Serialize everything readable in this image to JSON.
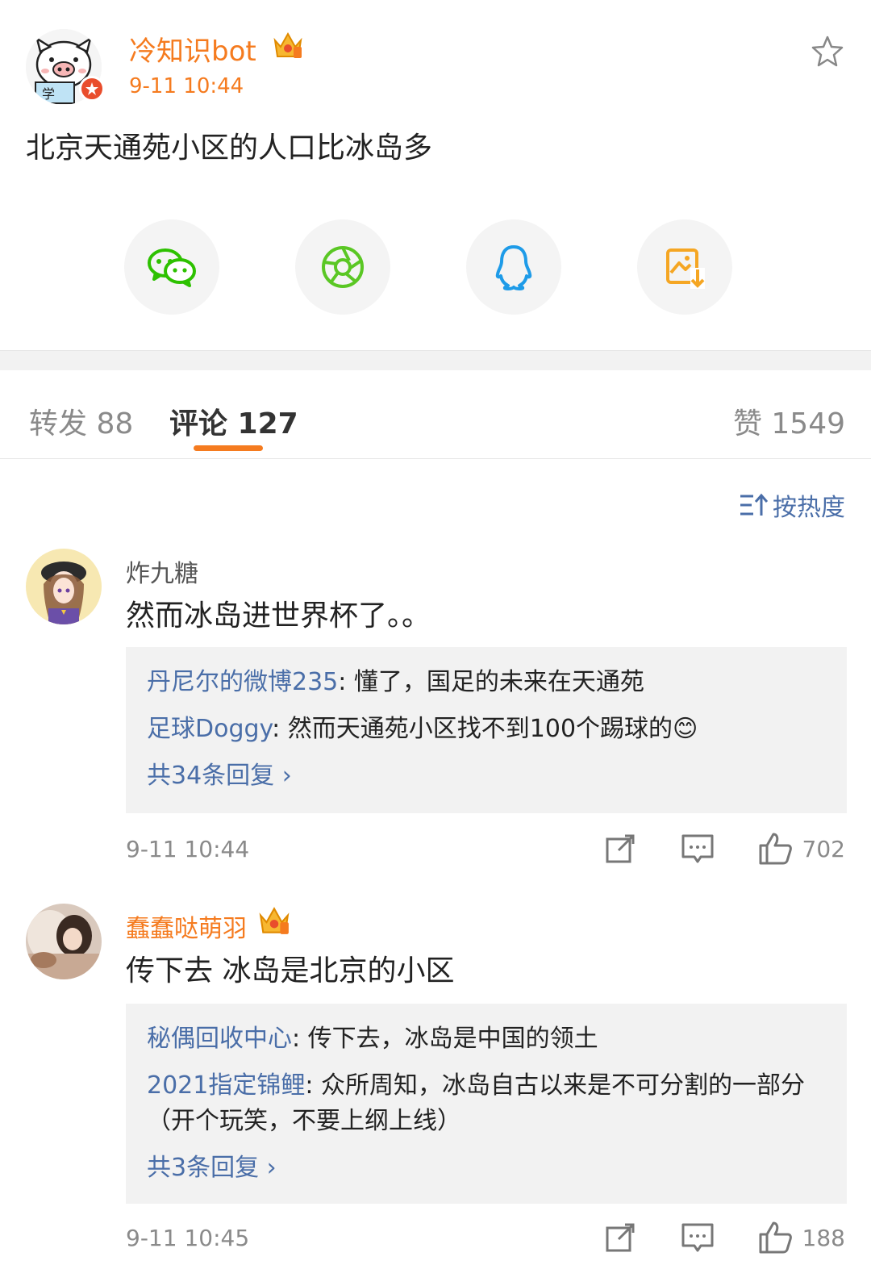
{
  "post": {
    "username": "冷知识bot",
    "time": "9-11 10:44",
    "text": "北京天通苑小区的人口比冰岛多"
  },
  "tabs": {
    "repost": "转发 88",
    "comment": "评论 127",
    "like": "赞 1549"
  },
  "sort_label": "按热度",
  "comments": [
    {
      "username": "炸九糖",
      "text": "然而冰岛进世界杯了。。",
      "replies": [
        {
          "user": "丹尼尔的微博235",
          "sep": ": ",
          "text": "懂了，国足的未来在天通苑"
        },
        {
          "user": "足球Doggy",
          "sep": ": ",
          "text": "然而天通苑小区找不到100个踢球的😊"
        }
      ],
      "more": "共34条回复",
      "time": "9-11 10:44",
      "likes": "702"
    },
    {
      "username": "蠢蠢哒萌羽",
      "text": "传下去 冰岛是北京的小区",
      "replies": [
        {
          "user": "秘偶回收中心",
          "sep": ": ",
          "text": "传下去，冰岛是中国的领土"
        },
        {
          "user": "2021指定锦鲤",
          "sep": ": ",
          "text": "众所周知，冰岛自古以来是不可分割的一部分（开个玩笑，不要上纲上线）"
        }
      ],
      "more": "共3条回复",
      "time": "9-11 10:45",
      "likes": "188"
    }
  ],
  "colors": {
    "accent": "#f57b1f",
    "link": "#4a6ea8",
    "wechat": "#2dc100",
    "moments": "#5ac724",
    "qq": "#1e9be8",
    "save": "#f5a623"
  }
}
